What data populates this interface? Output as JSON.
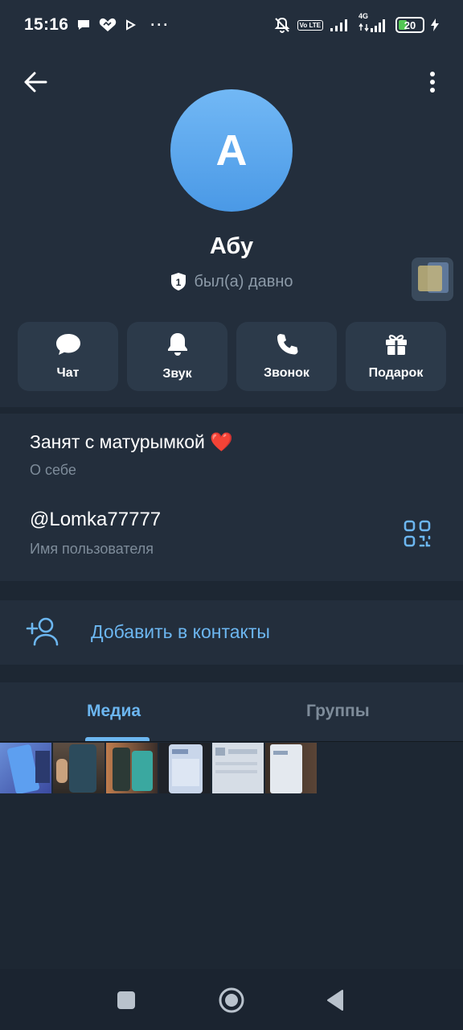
{
  "status_bar": {
    "time": "15:16",
    "dots": "···",
    "volte": "Vo LTE",
    "network": "4G",
    "battery": "20"
  },
  "profile": {
    "avatar_letter": "A",
    "name": "Абу",
    "badge": "1",
    "last_seen": "был(а) давно",
    "accent": "#6cb6f0"
  },
  "actions": [
    {
      "label": "Чат",
      "icon": "chat-bubble-icon"
    },
    {
      "label": "Звук",
      "icon": "bell-icon"
    },
    {
      "label": "Звонок",
      "icon": "phone-icon"
    },
    {
      "label": "Подарок",
      "icon": "gift-icon"
    }
  ],
  "info": {
    "bio": "Занят с матурымкой ❤️",
    "bio_label": "О себе",
    "username": "@Lomka77777",
    "username_label": "Имя пользователя"
  },
  "add_contact": {
    "label": "Добавить в контакты"
  },
  "tabs": [
    {
      "label": "Медиа",
      "active": true
    },
    {
      "label": "Группы",
      "active": false
    }
  ]
}
